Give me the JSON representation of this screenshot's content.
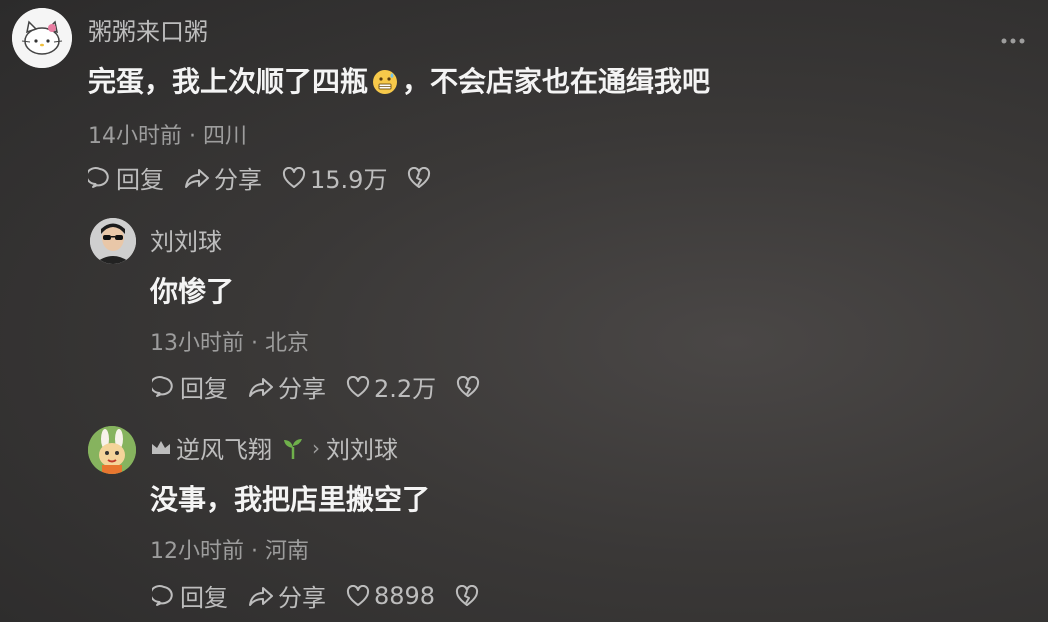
{
  "comments": [
    {
      "username": "粥粥来口粥",
      "content_before": "完蛋，我上次顺了四瓶",
      "content_after": "，不会店家也在通缉我吧",
      "time": "14小时前",
      "location": "四川",
      "reply_label": "回复",
      "share_label": "分享",
      "likes": "15.9万"
    },
    {
      "username": "刘刘球",
      "content": "你惨了",
      "time": "13小时前",
      "location": "北京",
      "reply_label": "回复",
      "share_label": "分享",
      "likes": "2.2万"
    },
    {
      "username": "逆风飞翔",
      "reply_to": "刘刘球",
      "content": "没事，我把店里搬空了",
      "time": "12小时前",
      "location": "河南",
      "reply_label": "回复",
      "share_label": "分享",
      "likes": "8898"
    }
  ],
  "icons": {
    "reply": "comment-bubble-icon",
    "share": "share-arrow-icon",
    "like": "heart-icon",
    "dislike": "broken-heart-icon",
    "more": "more-dots-icon",
    "crown": "crown-badge-icon",
    "sprout": "sprout-badge-icon",
    "emoji": "grimacing-sweat-emoji-icon"
  },
  "colors": {
    "sprout": "#6fb04b",
    "name": "#bdbdbd",
    "meta": "#9d9d9d"
  }
}
